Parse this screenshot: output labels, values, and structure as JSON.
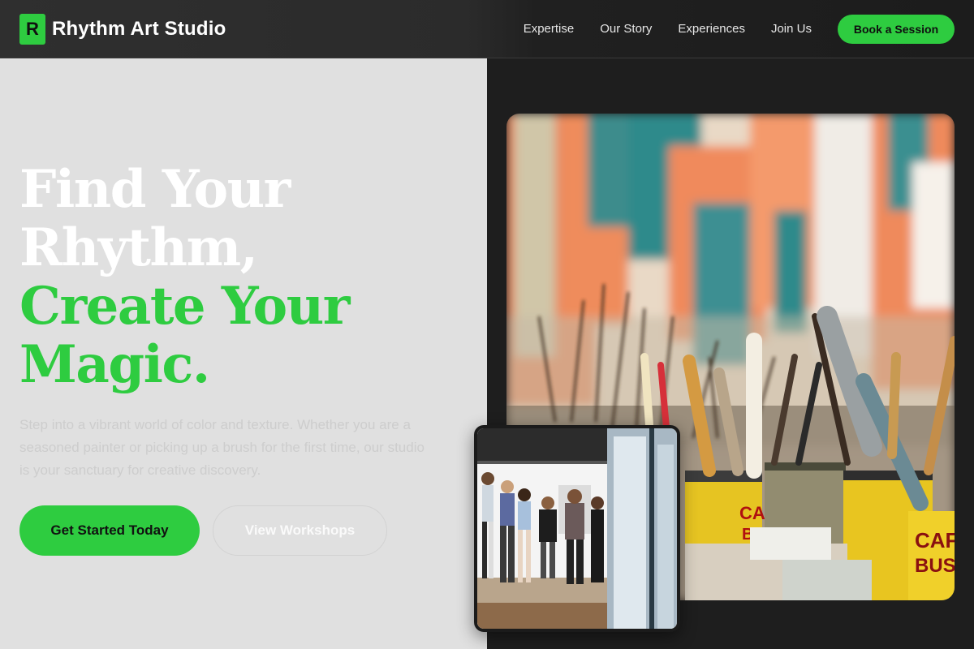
{
  "header": {
    "logo_letter": "R",
    "brand_name": "Rhythm Art Studio",
    "nav": [
      "Expertise",
      "Our Story",
      "Experiences",
      "Join Us"
    ],
    "cta_label": "Book a Session"
  },
  "hero": {
    "line1": "Find Your",
    "line2": "Rhythm,",
    "line3": "Create Your",
    "line4": "Magic.",
    "subtitle": "Step into a vibrant world of color and texture. Whether you are a seasoned painter or picking up a brush for the first time, our studio is your sanctuary for creative discovery.",
    "primary_button": "Get Started Today",
    "secondary_button": "View Workshops"
  },
  "images": {
    "main": "studio-paintbrushes-photo",
    "inset": "gallery-visitors-photo"
  },
  "colors": {
    "accent": "#2ecc40",
    "dark": "#1e1e1e",
    "light": "#e0e0e0"
  }
}
